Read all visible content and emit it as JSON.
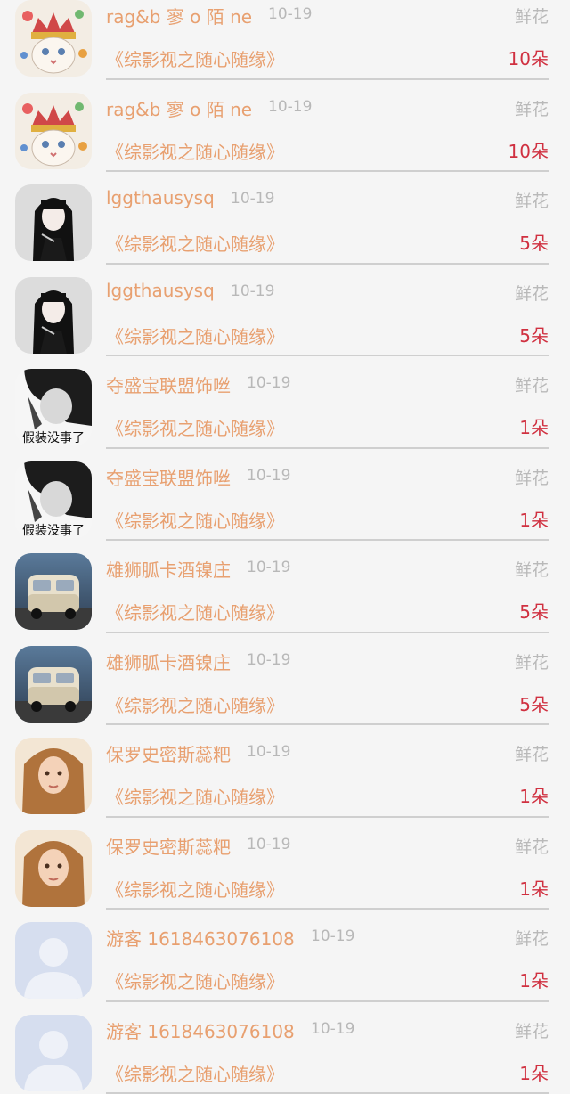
{
  "gift_label": "鲜花",
  "rows": [
    {
      "name": "rag&b 寥 o 陌 ne",
      "date": "10-19",
      "book": "《综影视之随心随缘》",
      "count": "10朵",
      "avatar": "cat"
    },
    {
      "name": "rag&b 寥 o 陌 ne",
      "date": "10-19",
      "book": "《综影视之随心随缘》",
      "count": "10朵",
      "avatar": "cat"
    },
    {
      "name": "lggthausysq",
      "date": "10-19",
      "book": "《综影视之随心随缘》",
      "count": "5朵",
      "avatar": "anime-girl"
    },
    {
      "name": "lggthausysq",
      "date": "10-19",
      "book": "《综影视之随心随缘》",
      "count": "5朵",
      "avatar": "anime-girl"
    },
    {
      "name": "夺盛宝联盟饰咝",
      "date": "10-19",
      "book": "《综影视之随心随缘》",
      "count": "1朵",
      "avatar": "bw-man",
      "avatar_caption": "假装没事了"
    },
    {
      "name": "夺盛宝联盟饰咝",
      "date": "10-19",
      "book": "《综影视之随心随缘》",
      "count": "1朵",
      "avatar": "bw-man",
      "avatar_caption": "假装没事了"
    },
    {
      "name": "雄狮胍卡酒镍庄",
      "date": "10-19",
      "book": "《综影视之随心随缘》",
      "count": "5朵",
      "avatar": "van"
    },
    {
      "name": "雄狮胍卡酒镍庄",
      "date": "10-19",
      "book": "《综影视之随心随缘》",
      "count": "5朵",
      "avatar": "van"
    },
    {
      "name": "保罗史密斯蕊粑",
      "date": "10-19",
      "book": "《综影视之随心随缘》",
      "count": "1朵",
      "avatar": "girl-photo"
    },
    {
      "name": "保罗史密斯蕊粑",
      "date": "10-19",
      "book": "《综影视之随心随缘》",
      "count": "1朵",
      "avatar": "girl-photo"
    },
    {
      "name": "游客 1618463076108",
      "date": "10-19",
      "book": "《综影视之随心随缘》",
      "count": "1朵",
      "avatar": "default-user"
    },
    {
      "name": "游客 1618463076108",
      "date": "10-19",
      "book": "《综影视之随心随缘》",
      "count": "1朵",
      "avatar": "default-user"
    }
  ]
}
